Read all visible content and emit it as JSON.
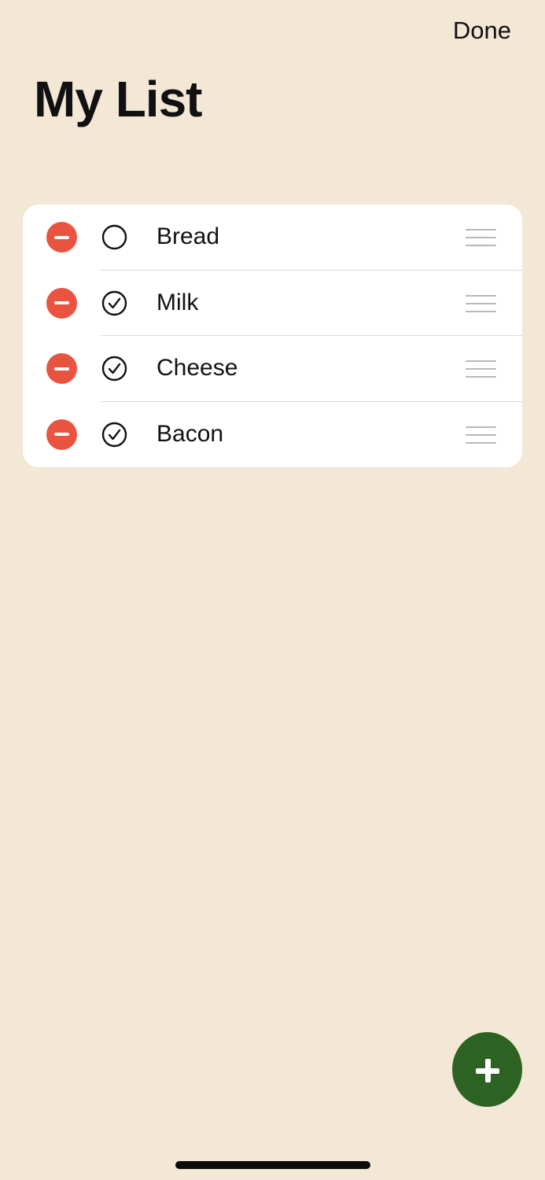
{
  "header": {
    "done_label": "Done",
    "title": "My List"
  },
  "list": {
    "items": [
      {
        "label": "Bread",
        "checked": false
      },
      {
        "label": "Milk",
        "checked": true
      },
      {
        "label": "Cheese",
        "checked": true
      },
      {
        "label": "Bacon",
        "checked": true
      }
    ]
  },
  "icons": {
    "delete": "minus-circle-icon",
    "unchecked": "circle-icon",
    "checked": "checkmark-circle-icon",
    "reorder": "drag-handle-icon",
    "add": "plus-icon"
  },
  "colors": {
    "background": "#f3e7d6",
    "card": "#ffffff",
    "delete": "#e95440",
    "add_button": "#2d6322",
    "text": "#111111"
  }
}
